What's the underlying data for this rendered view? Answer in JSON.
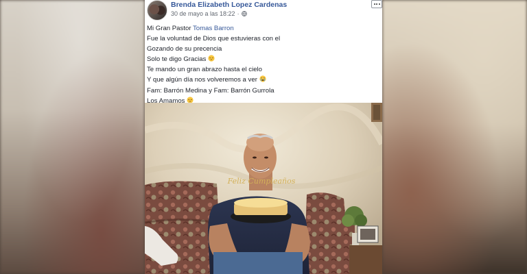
{
  "post": {
    "author": "Brenda Elizabeth Lopez Cardenas",
    "timestamp": "30 de mayo a las 18:22",
    "privacy_icon": "globe-icon",
    "more_icon": "more-options-icon",
    "message": {
      "line1_prefix": "Mi Gran Pastor ",
      "line1_mention": "Tomas Barron",
      "line2": "Fue la voluntad de Dios que estuvieras con el",
      "line3": "Gozando de su precencia",
      "line4": "Solo te digo Gracias",
      "line5": "Te mando un gran abrazo hasta el cielo",
      "line6": "Y que algún día nos volveremos a ver",
      "line7": "Fam: Barrón Medina y Fam: Barrón Gurrola",
      "line8": "Los Amamos",
      "emoji_pensive": "pensive-face-emoji",
      "emoji_crying": "crying-face-emoji"
    },
    "photo": {
      "cake_topper": "Feliz Cumpleaños"
    }
  },
  "colors": {
    "link": "#365899",
    "text": "#1d2129",
    "meta": "#616770",
    "emoji": "#f7c640"
  }
}
